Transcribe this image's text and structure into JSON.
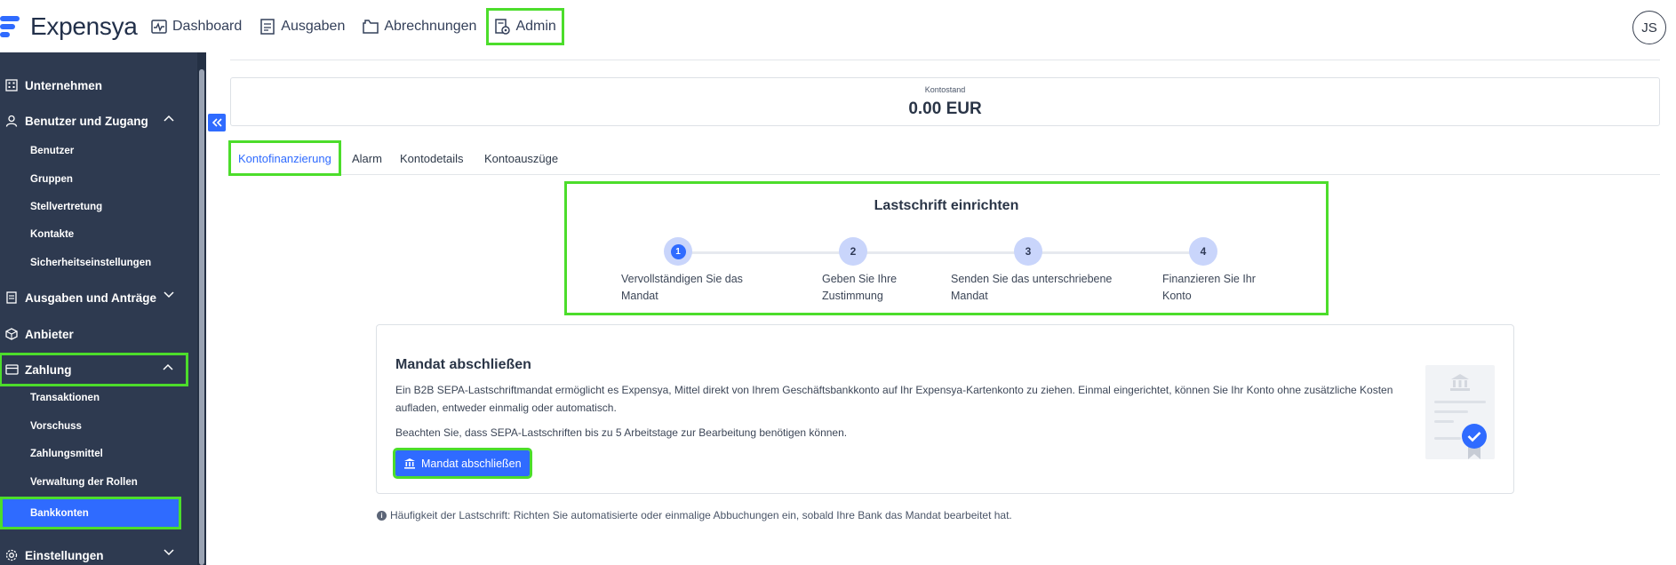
{
  "app": {
    "name": "Expensya",
    "brand_color": "#2f6bff",
    "highlight_color": "#4cdd2b"
  },
  "nav": {
    "items": [
      {
        "label": "Dashboard",
        "icon": "dashboard-icon"
      },
      {
        "label": "Ausgaben",
        "icon": "receipt-icon"
      },
      {
        "label": "Abrechnungen",
        "icon": "folder-icon"
      },
      {
        "label": "Admin",
        "icon": "admin-settings-icon"
      }
    ]
  },
  "user": {
    "initials": "JS"
  },
  "sidebar": {
    "sections": {
      "unternehmen": "Unternehmen",
      "benutzer": "Benutzer und Zugang",
      "ausgaben": "Ausgaben und Anträge",
      "anbieter": "Anbieter",
      "zahlung": "Zahlung",
      "einstellungen": "Einstellungen"
    },
    "benutzer_items": [
      "Benutzer",
      "Gruppen",
      "Stellvertretung",
      "Kontakte",
      "Sicherheitseinstellungen"
    ],
    "zahlung_items": [
      "Transaktionen",
      "Vorschuss",
      "Zahlungsmittel",
      "Verwaltung der Rollen",
      "Bankkonten"
    ]
  },
  "balance": {
    "label": "Kontostand",
    "value": "0.00 EUR"
  },
  "tabs": [
    "Kontofinanzierung",
    "Alarm",
    "Kontodetails",
    "Kontoauszüge"
  ],
  "stepper": {
    "title": "Lastschrift einrichten",
    "steps": [
      {
        "number": "1",
        "label": "Vervollständigen Sie das Mandat"
      },
      {
        "number": "2",
        "label": "Geben Sie Ihre Zustimmung"
      },
      {
        "number": "3",
        "label": "Senden Sie das unterschriebene Mandat"
      },
      {
        "number": "4",
        "label": "Finanzieren Sie Ihr Konto"
      }
    ]
  },
  "mandate": {
    "title": "Mandat abschließen",
    "description": "Ein B2B SEPA-Lastschriftmandat ermöglicht es Expensya, Mittel direkt von Ihrem Geschäftsbankkonto auf Ihr Expensya-Kartenkonto zu ziehen. Einmal eingerichtet, können Sie Ihr Konto ohne zusätzliche Kosten aufladen, entweder einmalig oder automatisch.",
    "note": "Beachten Sie, dass SEPA-Lastschriften bis zu 5 Arbeitstage zur Bearbeitung benötigen können.",
    "button": "Mandat abschließen"
  },
  "footnote": "Häufigkeit der Lastschrift: Richten Sie automatisierte oder einmalige Abbuchungen ein, sobald Ihre Bank das Mandat bearbeitet hat."
}
